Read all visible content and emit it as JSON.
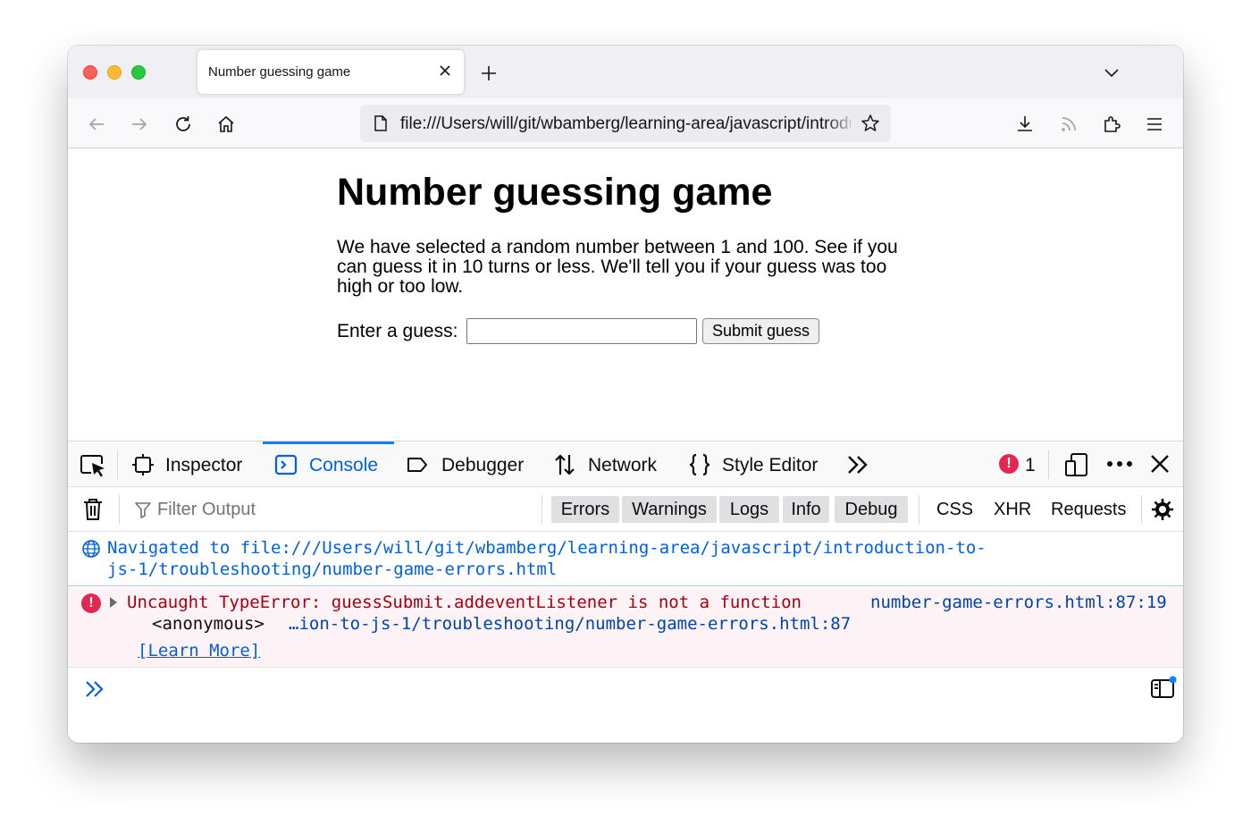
{
  "browser": {
    "tab_title": "Number guessing game",
    "url": "file:///Users/will/git/wbamberg/learning-area/javascript/introduction-to-js-1/troubleshooting/number-game-errors.html"
  },
  "page": {
    "heading": "Number guessing game",
    "intro": "We have selected a random number between 1 and 100. See if you can guess it in 10 turns or less. We'll tell you if your guess was too high or too low.",
    "guess_label": "Enter a guess:",
    "guess_value": "",
    "submit_label": "Submit guess"
  },
  "devtools": {
    "tabs": [
      {
        "label": "Inspector"
      },
      {
        "label": "Console"
      },
      {
        "label": "Debugger"
      },
      {
        "label": "Network"
      },
      {
        "label": "Style Editor"
      }
    ],
    "error_count": "1",
    "filter_placeholder": "Filter Output",
    "filter_buttons": [
      "Errors",
      "Warnings",
      "Logs",
      "Info",
      "Debug"
    ],
    "filter_plain": [
      "CSS",
      "XHR",
      "Requests"
    ],
    "nav_message_line1": "Navigated to file:///Users/will/git/wbamberg/learning-area/javascript/introduction-to-",
    "nav_message_line2": "js-1/troubleshooting/number-game-errors.html",
    "error_message": "Uncaught TypeError: guessSubmit.addeventListener is not a function",
    "error_location": "number-game-errors.html:87:19",
    "stack_function": "<anonymous>",
    "stack_location": "…ion-to-js-1/troubleshooting/number-game-errors.html:87",
    "learn_more": "[Learn More]"
  },
  "colors": {
    "accent": "#0060df",
    "error": "#e22850",
    "error_text": "#a4000f",
    "error_bg": "#fdf2f5"
  }
}
